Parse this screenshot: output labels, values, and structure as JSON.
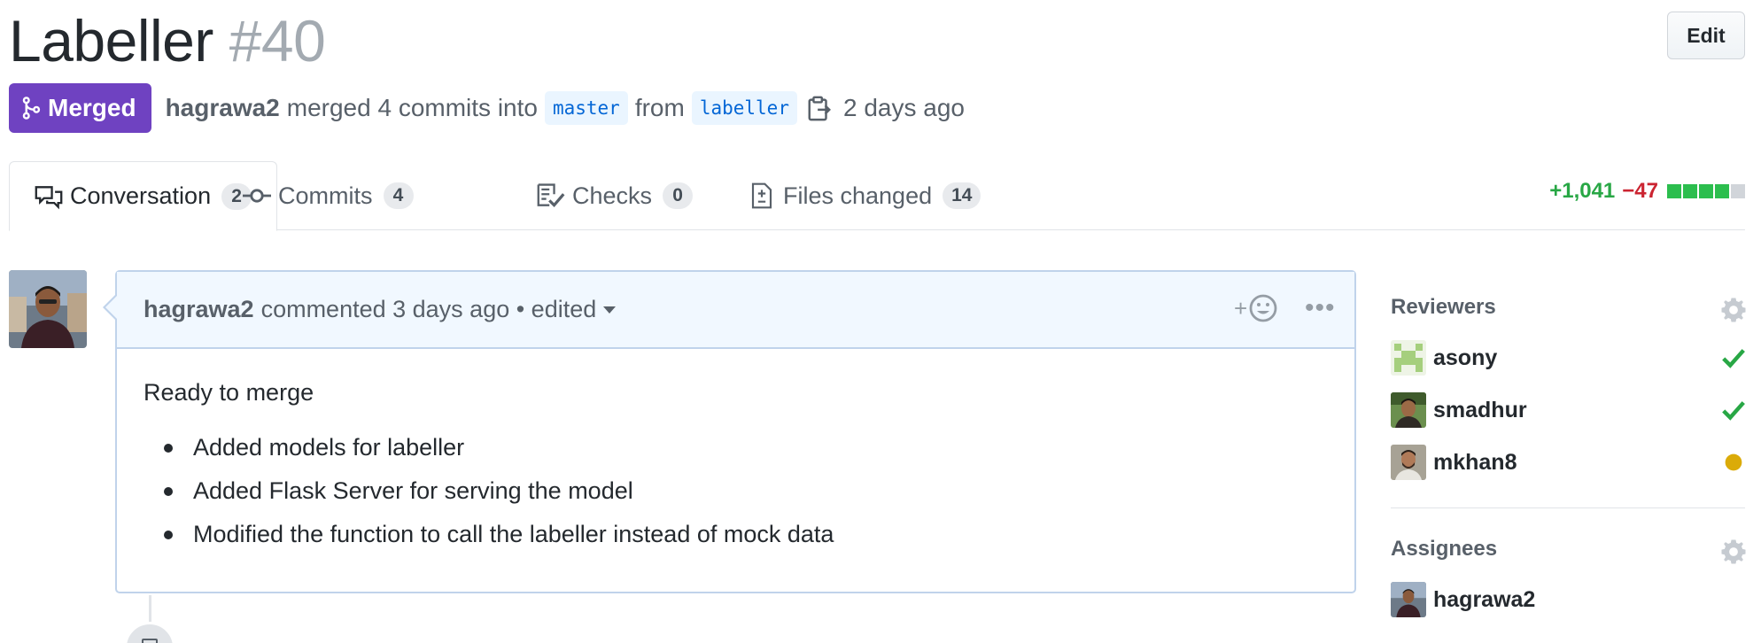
{
  "pr": {
    "title": "Labeller",
    "number": "#40",
    "edit_label": "Edit",
    "state_label": "Merged",
    "author": "hagrawa2",
    "merge_text": "merged 4 commits into",
    "base_branch": "master",
    "from_text": "from",
    "head_branch": "labeller",
    "time_text": "2 days ago"
  },
  "tabs": [
    {
      "label": "Conversation",
      "count": "2",
      "icon": "comment-discussion-icon"
    },
    {
      "label": "Commits",
      "count": "4",
      "icon": "git-commit-icon"
    },
    {
      "label": "Checks",
      "count": "0",
      "icon": "checklist-icon"
    },
    {
      "label": "Files changed",
      "count": "14",
      "icon": "file-diff-icon"
    }
  ],
  "diffstat": {
    "additions": "+1,041",
    "deletions": "−47",
    "blocks": [
      "add",
      "add",
      "add",
      "add",
      "neutral"
    ]
  },
  "comment": {
    "author": "hagrawa2",
    "meta": "commented 3 days ago • edited",
    "reaction_label": "+",
    "body_intro": "Ready to merge",
    "items": [
      "Added models for labeller",
      "Added Flask Server for serving the model",
      "Modified the function to call the labeller instead of mock data"
    ]
  },
  "sidebar": {
    "reviewers_heading": "Reviewers",
    "reviewers": [
      {
        "name": "asony",
        "status": "approved"
      },
      {
        "name": "smadhur",
        "status": "approved"
      },
      {
        "name": "mkhan8",
        "status": "pending"
      }
    ],
    "assignees_heading": "Assignees",
    "assignees": [
      {
        "name": "hagrawa2"
      }
    ]
  },
  "colors": {
    "merged": "#6f42c1",
    "additions": "#28a745",
    "deletions": "#cb2431",
    "pending": "#dbab09",
    "link": "#0366d6"
  }
}
